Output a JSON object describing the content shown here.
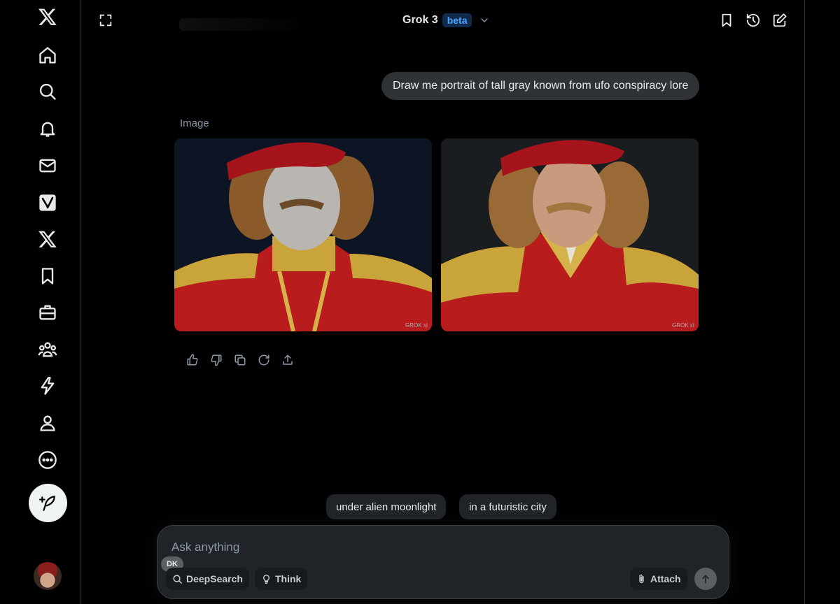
{
  "header": {
    "model_name": "Grok 3",
    "badge": "beta"
  },
  "nav": {
    "items": [
      "x-logo-icon",
      "home-icon",
      "search-icon",
      "notifications-icon",
      "messages-icon",
      "grok-icon",
      "x-icon",
      "bookmarks-icon",
      "jobs-icon",
      "communities-icon",
      "premium-icon",
      "profile-icon",
      "more-icon"
    ]
  },
  "chat": {
    "user_message": "Draw me portrait of tall gray known from ufo conspiracy lore",
    "response_label": "Image",
    "images": [
      {
        "watermark": "GROK xI"
      },
      {
        "watermark": "GROK xI"
      }
    ]
  },
  "suggestions": [
    "under alien moonlight",
    "in a futuristic city"
  ],
  "composer": {
    "placeholder": "Ask anything",
    "user_initials": "DK",
    "deepsearch_label": "DeepSearch",
    "think_label": "Think",
    "attach_label": "Attach"
  },
  "colors": {
    "background": "#000000",
    "bubble": "#2f3336",
    "accent": "#4aa3ff",
    "composer": "#202327"
  }
}
